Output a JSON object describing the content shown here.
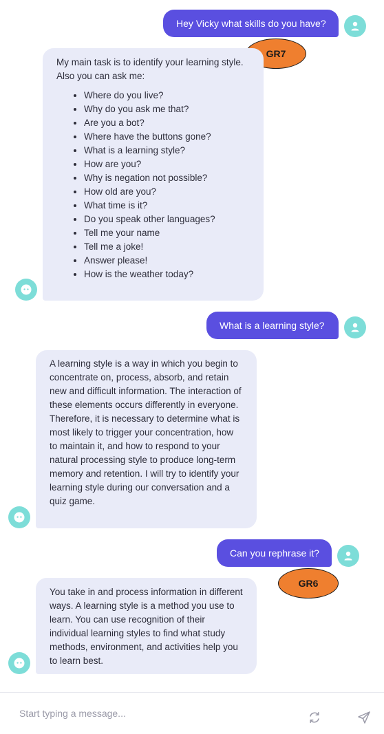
{
  "messages": [
    {
      "sender": "user",
      "text": "Hey Vicky what skills do you have?"
    },
    {
      "sender": "bot",
      "intro": "My main task is to identify your learning style. Also you can ask me:",
      "items": [
        "Where do you live?",
        "Why do you ask me that?",
        "Are you a bot?",
        "Where have the buttons gone?",
        "What is a learning style?",
        "How are you?",
        "Why is negation not possible?",
        "How old are you?",
        "What time is it?",
        "Do you speak other languages?",
        "Tell me your name",
        "Tell me a joke!",
        "Answer please!",
        "How is the weather today?"
      ]
    },
    {
      "sender": "user",
      "text": "What is a learning style?"
    },
    {
      "sender": "bot",
      "text": "A learning style is a way in which you begin to concentrate on, process, absorb, and retain new and difficult information. The interaction of these elements occurs differently in everyone. Therefore, it is necessary to determine what is most likely to trigger your concentration, how to maintain it, and how to respond to your natural processing style to produce long-term memory and retention. I will try to identify your learning style during our conversation and a quiz game."
    },
    {
      "sender": "user",
      "text": "Can you rephrase it?"
    },
    {
      "sender": "bot",
      "text": "You take in and process information in different ways. A learning style is a method you use to learn. You can use recognition of their individual learning styles to find what study methods, environment, and activities help you to learn best."
    }
  ],
  "annotations": [
    {
      "label": "GR7",
      "color": "#ef7f2f"
    },
    {
      "label": "GR6",
      "color": "#ef7f2f"
    }
  ],
  "composer": {
    "placeholder": "Start typing a message...",
    "refresh_icon": "refresh-icon",
    "send_icon": "send-icon"
  },
  "colors": {
    "user_bubble": "#5a4fe0",
    "bot_bubble": "#e9ebf8",
    "avatar": "#7dddd8",
    "annotation": "#ef7f2f"
  }
}
